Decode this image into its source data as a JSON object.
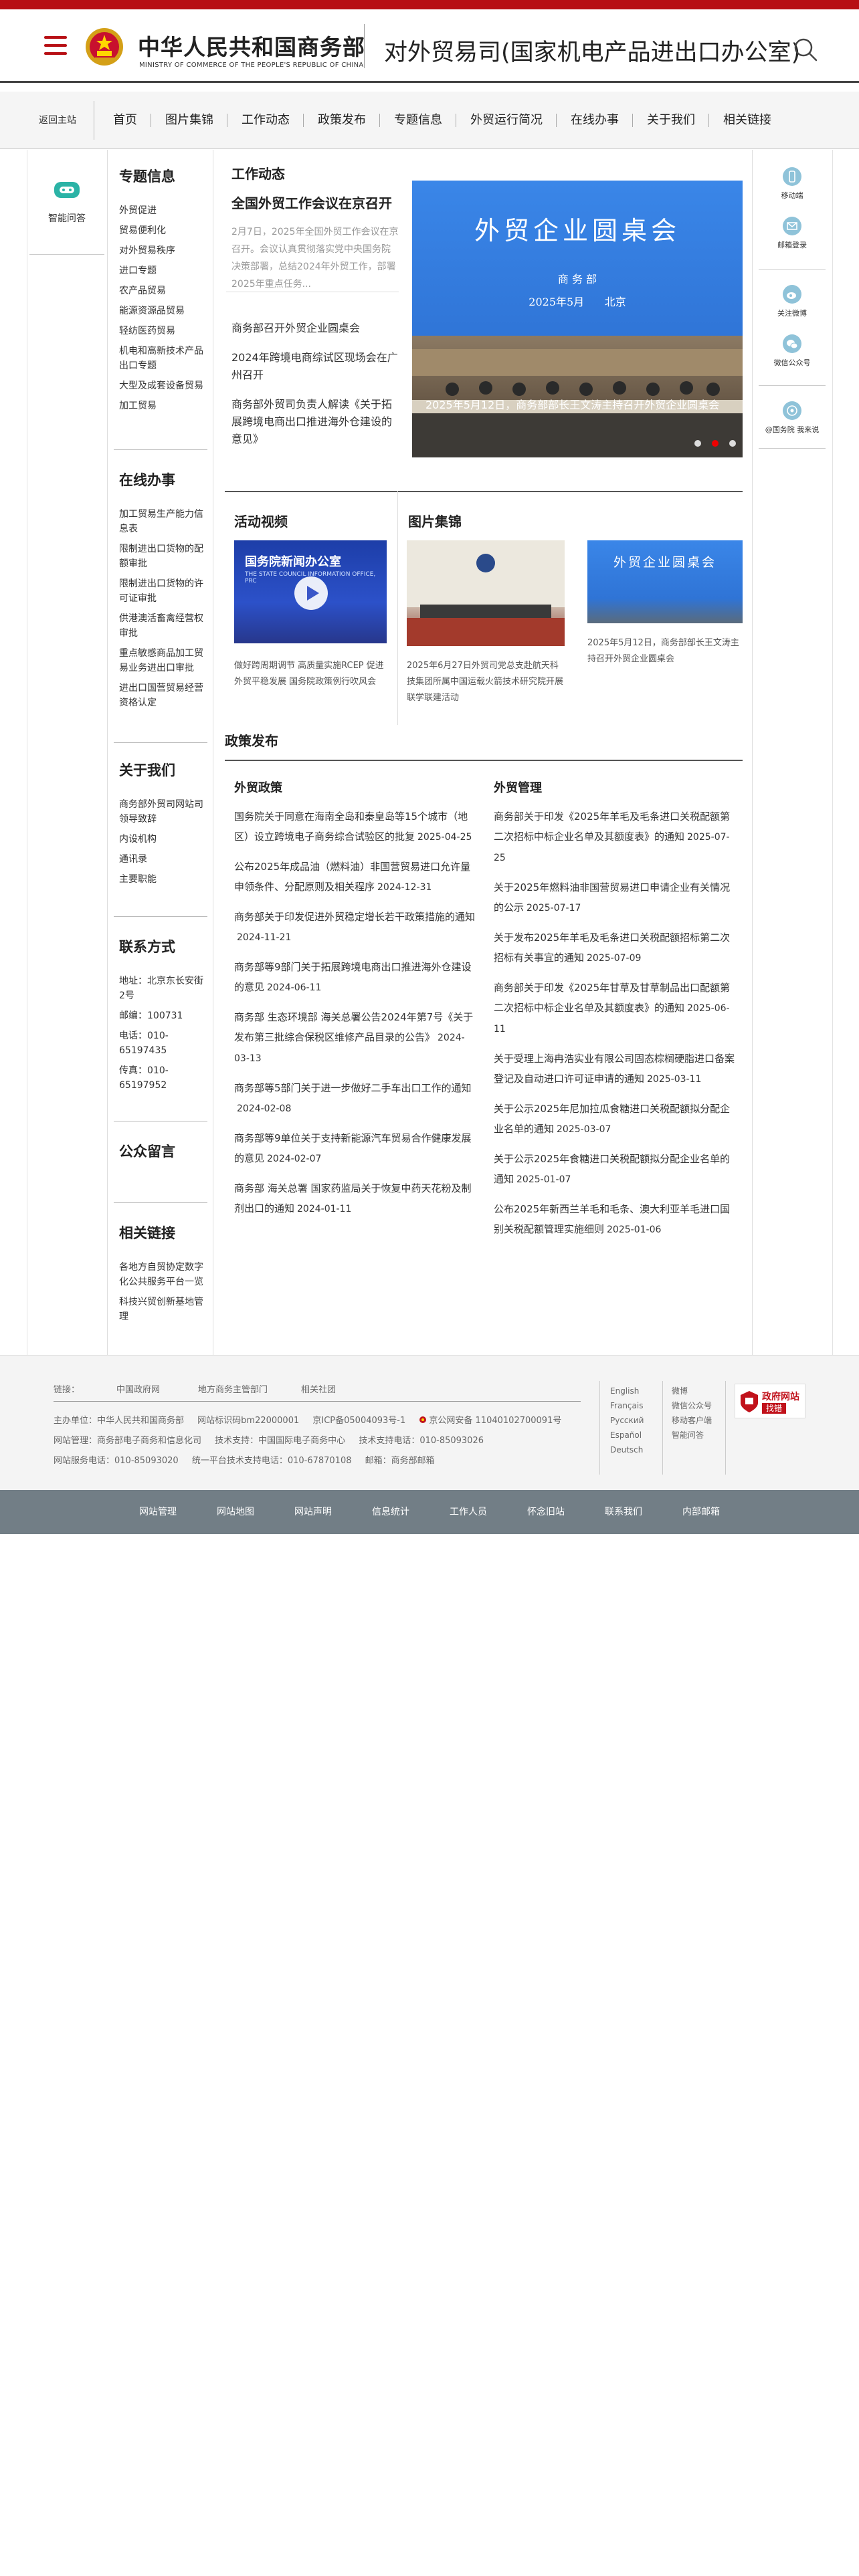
{
  "header": {
    "site_name_cn": "中华人民共和国商务部",
    "site_name_en": "MINISTRY OF COMMERCE OF THE PEOPLE'S REPUBLIC OF CHINA",
    "department": "对外贸易司(国家机电产品进出口办公室)"
  },
  "nav": {
    "home_back": "返回主站",
    "items": [
      "首页",
      "图片集锦",
      "工作动态",
      "政策发布",
      "专题信息",
      "外贸运行简况",
      "在线办事",
      "关于我们",
      "相关链接"
    ]
  },
  "assistant": {
    "label": "智能问答"
  },
  "left_sidebar": {
    "topics": {
      "title": "专题信息",
      "items": [
        "外贸促进",
        "贸易便利化",
        "对外贸易秩序",
        "进口专题",
        "农产品贸易",
        "能源资源品贸易",
        "轻纺医药贸易",
        "机电和高新技术产品出口专题",
        "大型及成套设备贸易",
        "加工贸易"
      ]
    },
    "online": {
      "title": "在线办事",
      "items": [
        "加工贸易生产能力信息表",
        "限制进出口货物的配额审批",
        "限制进出口货物的许可证审批",
        "供港澳活畜禽经营权审批",
        "重点敏感商品加工贸易业务进出口审批",
        "进出口国营贸易经营资格认定"
      ]
    },
    "about": {
      "title": "关于我们",
      "items": [
        "商务部外贸司网站司领导致辞",
        "内设机构",
        "通讯录",
        "主要职能"
      ]
    },
    "contact": {
      "title": "联系方式",
      "items": [
        "地址：北京东长安街2号",
        "邮编：100731",
        "电话：010-65197435",
        "传真：010-65197952"
      ]
    },
    "message": {
      "title": "公众留言"
    },
    "links": {
      "title": "相关链接",
      "items": [
        "各地方自贸协定数字化公共服务平台一览",
        "科技兴贸创新基地管理"
      ]
    }
  },
  "work_news": {
    "section_title": "工作动态",
    "feature_title": "全国外贸工作会议在京召开",
    "feature_summary": "2月7日，2025年全国外贸工作会议在京召开。会议认真贯彻落实党中央国务院决策部署，总结2024年外贸工作，部署2025年重点任务...",
    "items": [
      "商务部召开外贸企业圆桌会",
      "2024年跨境电商综试区现场会在广州召开",
      "商务部外贸司负责人解读《关于拓展跨境电商出口推进海外仓建设的意见》"
    ]
  },
  "carousel": {
    "heading": "外贸企业圆桌会",
    "org": "商 务 部",
    "date": "2025年5月      北京",
    "caption": "2025年5月12日，商务部部长王文涛主持召开外贸企业圆桌会"
  },
  "video": {
    "section_title": "活动视频",
    "thumb_title": "国务院新闻办公室",
    "thumb_sub": "THE STATE COUNCIL INFORMATION OFFICE, PRC",
    "caption": "做好跨周期调节 高质量实施RCEP 促进外贸平稳发展 国务院政策例行吹风会"
  },
  "gallery": {
    "section_title": "图片集锦",
    "photo1_caption": "2025年6月27日外贸司党总支赴航天科技集团所属中国运载火箭技术研究院开展联学联建活动",
    "photo2_heading": "外贸企业圆桌会",
    "photo2_caption": "2025年5月12日，商务部部长王文涛主持召开外贸企业圆桌会"
  },
  "policy": {
    "section_title": "政策发布",
    "left": {
      "title": "外贸政策",
      "items": [
        {
          "text": "国务院关于同意在海南全岛和秦皇岛等15个城市（地区）设立跨境电子商务综合试验区的批复",
          "date": "2025-04-25"
        },
        {
          "text": "公布2025年成品油（燃料油）非国营贸易进口允许量申领条件、分配原则及相关程序",
          "date": "2024-12-31"
        },
        {
          "text": "商务部关于印发促进外贸稳定增长若干政策措施的通知",
          "date": "2024-11-21"
        },
        {
          "text": "商务部等9部门关于拓展跨境电商出口推进海外仓建设的意见",
          "date": "2024-06-11"
        },
        {
          "text": "商务部 生态环境部 海关总署公告2024年第7号《关于发布第三批综合保税区维修产品目录的公告》",
          "date": "2024-03-13"
        },
        {
          "text": "商务部等5部门关于进一步做好二手车出口工作的通知",
          "date": "2024-02-08"
        },
        {
          "text": "商务部等9单位关于支持新能源汽车贸易合作健康发展的意见",
          "date": "2024-02-07"
        },
        {
          "text": "商务部 海关总署 国家药监局关于恢复中药天花粉及制剂出口的通知",
          "date": "2024-01-11"
        }
      ]
    },
    "right": {
      "title": "外贸管理",
      "items": [
        {
          "text": "商务部关于印发《2025年羊毛及毛条进口关税配额第二次招标中标企业名单及其额度表》的通知",
          "date": "2025-07-25"
        },
        {
          "text": "关于2025年燃料油非国营贸易进口申请企业有关情况的公示",
          "date": "2025-07-17"
        },
        {
          "text": "关于发布2025年羊毛及毛条进口关税配额招标第二次招标有关事宜的通知",
          "date": "2025-07-09"
        },
        {
          "text": "商务部关于印发《2025年甘草及甘草制品出口配额第二次招标中标企业名单及其额度表》的通知",
          "date": "2025-06-11"
        },
        {
          "text": "关于受理上海冉浩实业有限公司固态棕榈硬脂进口备案登记及自动进口许可证申请的通知",
          "date": "2025-03-11"
        },
        {
          "text": "关于公示2025年尼加拉瓜食糖进口关税配额拟分配企业名单的通知",
          "date": "2025-03-07"
        },
        {
          "text": "关于公示2025年食糖进口关税配额拟分配企业名单的通知",
          "date": "2025-01-07"
        },
        {
          "text": "公布2025年新西兰羊毛和毛条、澳大利亚羊毛进口国别关税配额管理实施细则",
          "date": "2025-01-06"
        }
      ]
    }
  },
  "right_panel": {
    "items": [
      "移动端",
      "邮箱登录",
      "关注微博",
      "微信公众号",
      "@国务院 我来说"
    ]
  },
  "footer": {
    "links_label": "链接：",
    "links": [
      "中国政府网",
      "地方商务主管部门",
      "相关社团"
    ],
    "line1": [
      "主办单位：中华人民共和国商务部",
      "网站标识码bm22000001",
      "京ICP备05004093号-1",
      "京公网安备 11040102700091号"
    ],
    "line2": [
      "网站管理：商务部电子商务和信息化司",
      "技术支持：中国国际电子商务中心",
      "技术支持电话：010-85093026"
    ],
    "line3": [
      "网站服务电话：010-85093020",
      "统一平台技术支持电话：010-67870108",
      "邮箱：商务部邮箱"
    ],
    "languages": [
      "English",
      "Français",
      "Русский",
      "Español",
      "Deutsch"
    ],
    "social": [
      "微博",
      "微信公众号",
      "移动客户端",
      "智能问答"
    ],
    "badge_title": "政府网站",
    "badge_sub": "找错"
  },
  "bottom_bar": {
    "items": [
      "网站管理",
      "网站地图",
      "网站声明",
      "信息统计",
      "工作人员",
      "怀念旧站",
      "联系我们",
      "内部邮箱"
    ]
  },
  "colors": {
    "brand_red": "#b70f14",
    "bottom_bar": "#727e86",
    "accent_blue": "#2f74d6"
  }
}
